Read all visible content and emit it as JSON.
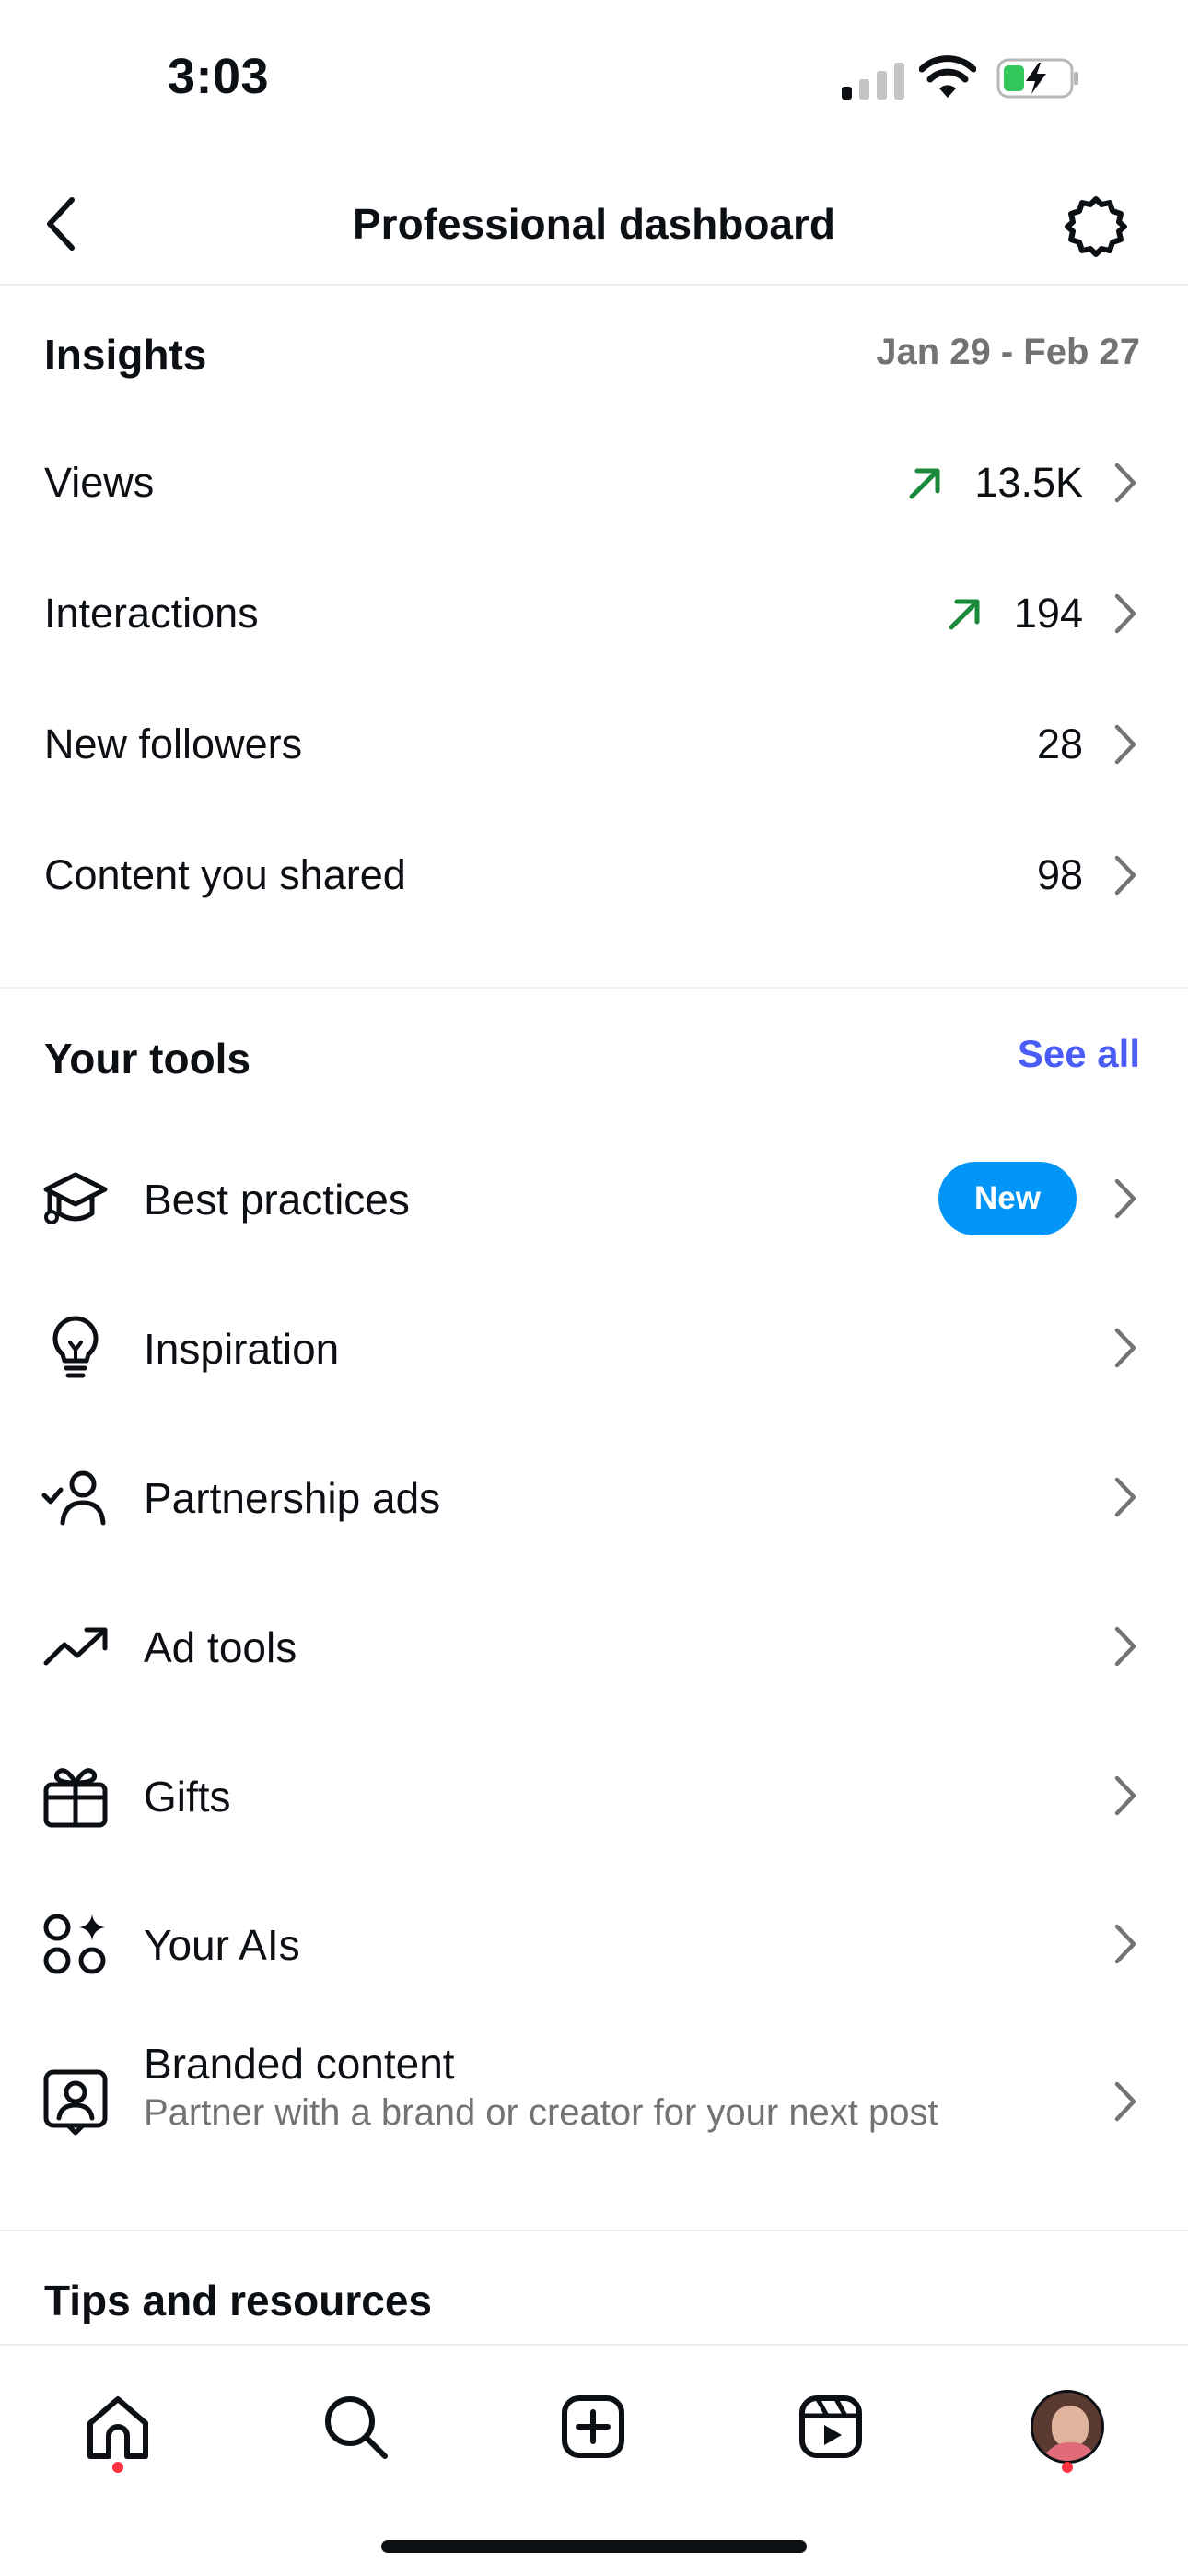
{
  "status_bar": {
    "time": "3:03"
  },
  "header": {
    "title": "Professional dashboard"
  },
  "insights": {
    "heading": "Insights",
    "date_range": "Jan 29 - Feb 27",
    "metrics": [
      {
        "label": "Views",
        "value": "13.5K",
        "trend": "up"
      },
      {
        "label": "Interactions",
        "value": "194",
        "trend": "up"
      },
      {
        "label": "New followers",
        "value": "28",
        "trend": "none"
      },
      {
        "label": "Content you shared",
        "value": "98",
        "trend": "none"
      }
    ]
  },
  "tools": {
    "heading": "Your tools",
    "see_all": "See all",
    "items": [
      {
        "label": "Best practices",
        "icon": "graduation-cap-icon",
        "badge": "New"
      },
      {
        "label": "Inspiration",
        "icon": "lightbulb-icon"
      },
      {
        "label": "Partnership ads",
        "icon": "person-check-icon"
      },
      {
        "label": "Ad tools",
        "icon": "trending-up-icon"
      },
      {
        "label": "Gifts",
        "icon": "gift-icon"
      },
      {
        "label": "Your AIs",
        "icon": "ai-sparkle-icon"
      },
      {
        "label": "Branded content",
        "sublabel": "Partner with a brand or creator for your next post",
        "icon": "branded-content-icon"
      }
    ]
  },
  "tips": {
    "heading": "Tips and resources"
  },
  "bottom_nav": {
    "items": [
      "home-icon",
      "search-icon",
      "create-icon",
      "reels-icon",
      "profile-avatar"
    ]
  },
  "colors": {
    "accent_blue": "#4a5df9",
    "badge_blue": "#0095f6",
    "trend_green": "#1a8a3a",
    "secondary_text": "#737373",
    "notification_red": "#ff3040"
  }
}
